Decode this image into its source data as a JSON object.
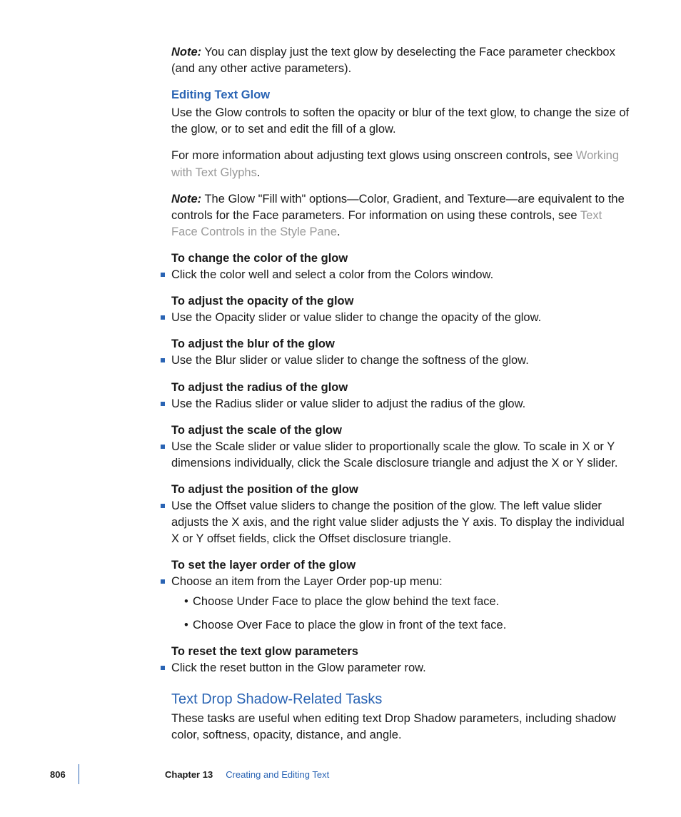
{
  "note1": {
    "label": "Note:",
    "text": "You can display just the text glow by deselecting the Face parameter checkbox (and any other active parameters)."
  },
  "section1": {
    "heading": "Editing Text Glow",
    "para": "Use the Glow controls to soften the opacity or blur of the text glow, to change the size of the glow, or to set and edit the fill of a glow."
  },
  "para2a": "For more information about adjusting text glows using onscreen controls, see ",
  "link1": "Working with Text Glyphs",
  "para2b": ".",
  "note2": {
    "label": "Note:",
    "text": "The Glow \"Fill with\" options—Color, Gradient, and Texture—are equivalent to the controls for the Face parameters. For information on using these controls, see ",
    "link": "Text Face Controls in the Style Pane",
    "after": "."
  },
  "tasks": [
    {
      "title": "To change the color of the glow",
      "items": [
        "Click the color well and select a color from the Colors window."
      ]
    },
    {
      "title": "To adjust the opacity of the glow",
      "items": [
        "Use the Opacity slider or value slider to change the opacity of the glow."
      ]
    },
    {
      "title": "To adjust the blur of the glow",
      "items": [
        "Use the Blur slider or value slider to change the softness of the glow."
      ]
    },
    {
      "title": "To adjust the radius of the glow",
      "items": [
        "Use the Radius slider or value slider to adjust the radius of the glow."
      ]
    },
    {
      "title": "To adjust the scale of the glow",
      "items": [
        "Use the Scale slider or value slider to proportionally scale the glow. To scale in X or Y dimensions individually, click the Scale disclosure triangle and adjust the X or Y slider."
      ]
    },
    {
      "title": "To adjust the position of the glow",
      "items": [
        "Use the Offset value sliders to change the position of the glow. The left value slider adjusts the X axis, and the right value slider adjusts the Y axis. To display the individual X or Y offset fields, click the Offset disclosure triangle."
      ]
    },
    {
      "title": "To set the layer order of the glow",
      "items": [
        "Choose an item from the Layer Order pop-up menu:"
      ],
      "sub": [
        "Choose Under Face to place the glow behind the text face.",
        "Choose Over Face to place the glow in front of the text face."
      ]
    },
    {
      "title": "To reset the text glow parameters",
      "items": [
        "Click the reset button in the Glow parameter row."
      ]
    }
  ],
  "section2": {
    "heading": "Text Drop Shadow-Related Tasks",
    "para": "These tasks are useful when editing text Drop Shadow parameters, including shadow color, softness, opacity, distance, and angle."
  },
  "footer": {
    "page": "806",
    "chapter": "Chapter 13",
    "title": "Creating and Editing Text"
  }
}
